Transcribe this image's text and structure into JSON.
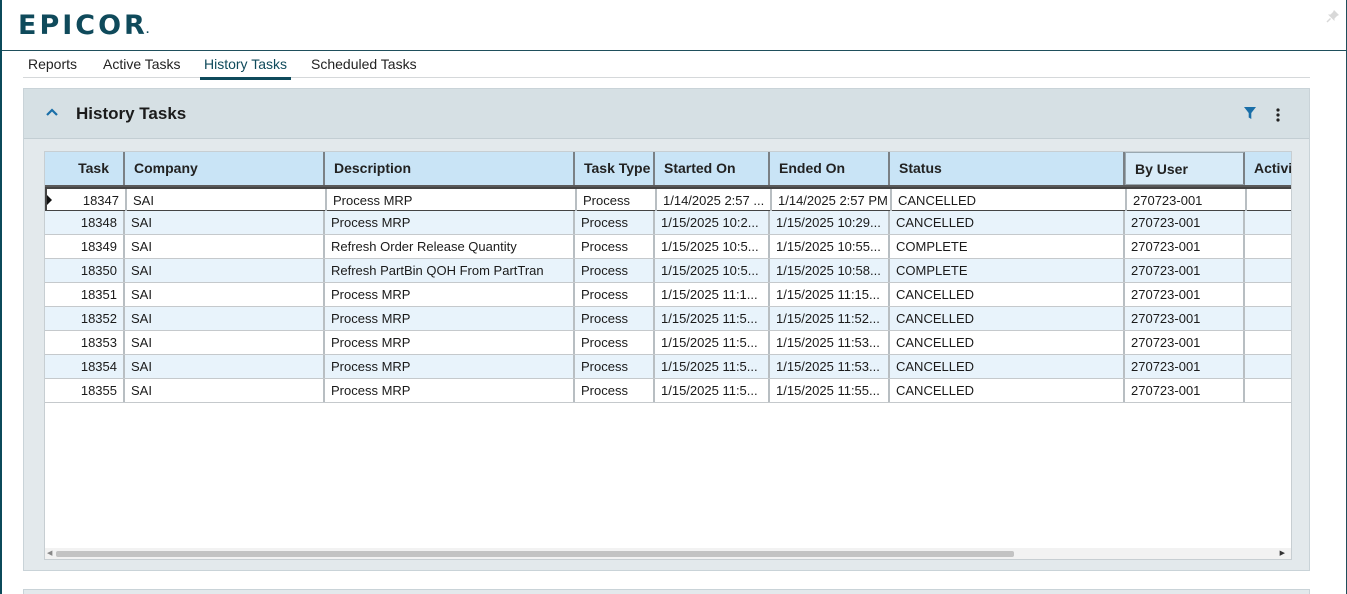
{
  "app": {
    "logo_text": "EPICOR",
    "logo_mark": "."
  },
  "tabs": [
    {
      "label": "Reports"
    },
    {
      "label": "Active Tasks"
    },
    {
      "label": "History Tasks",
      "active": true
    },
    {
      "label": "Scheduled Tasks"
    }
  ],
  "panel": {
    "title": "History Tasks"
  },
  "grid": {
    "columns": [
      "Task",
      "Company",
      "Description",
      "Task Type",
      "Started On",
      "Ended On",
      "Status",
      "By User",
      "Activi"
    ],
    "rows": [
      {
        "task": "18347",
        "company": "SAI",
        "description": "Process MRP",
        "task_type": "Process",
        "started_on": "1/14/2025 2:57 ...",
        "ended_on": "1/14/2025 2:57 PM",
        "status": "CANCELLED",
        "by_user": "270723-001"
      },
      {
        "task": "18348",
        "company": "SAI",
        "description": "Process MRP",
        "task_type": "Process",
        "started_on": "1/15/2025 10:2...",
        "ended_on": "1/15/2025 10:29...",
        "status": "CANCELLED",
        "by_user": "270723-001"
      },
      {
        "task": "18349",
        "company": "SAI",
        "description": "Refresh Order Release Quantity",
        "task_type": "Process",
        "started_on": "1/15/2025 10:5...",
        "ended_on": "1/15/2025 10:55...",
        "status": "COMPLETE",
        "by_user": "270723-001"
      },
      {
        "task": "18350",
        "company": "SAI",
        "description": "Refresh PartBin QOH From PartTran",
        "task_type": "Process",
        "started_on": "1/15/2025 10:5...",
        "ended_on": "1/15/2025 10:58...",
        "status": "COMPLETE",
        "by_user": "270723-001"
      },
      {
        "task": "18351",
        "company": "SAI",
        "description": "Process MRP",
        "task_type": "Process",
        "started_on": "1/15/2025 11:1...",
        "ended_on": "1/15/2025 11:15...",
        "status": "CANCELLED",
        "by_user": "270723-001"
      },
      {
        "task": "18352",
        "company": "SAI",
        "description": "Process MRP",
        "task_type": "Process",
        "started_on": "1/15/2025 11:5...",
        "ended_on": "1/15/2025 11:52...",
        "status": "CANCELLED",
        "by_user": "270723-001"
      },
      {
        "task": "18353",
        "company": "SAI",
        "description": "Process MRP",
        "task_type": "Process",
        "started_on": "1/15/2025 11:5...",
        "ended_on": "1/15/2025 11:53...",
        "status": "CANCELLED",
        "by_user": "270723-001"
      },
      {
        "task": "18354",
        "company": "SAI",
        "description": "Process MRP",
        "task_type": "Process",
        "started_on": "1/15/2025 11:5...",
        "ended_on": "1/15/2025 11:53...",
        "status": "CANCELLED",
        "by_user": "270723-001"
      },
      {
        "task": "18355",
        "company": "SAI",
        "description": "Process MRP",
        "task_type": "Process",
        "started_on": "1/15/2025 11:5...",
        "ended_on": "1/15/2025 11:55...",
        "status": "CANCELLED",
        "by_user": "270723-001"
      }
    ]
  },
  "icons": {
    "collapse": "chevron-up-icon",
    "filter": "filter-icon",
    "more": "more-vertical-icon",
    "pin": "pin-icon"
  },
  "colors": {
    "brand": "#0f4a5b",
    "accent": "#1a6fa8",
    "header_bg": "#c9e4f6"
  }
}
